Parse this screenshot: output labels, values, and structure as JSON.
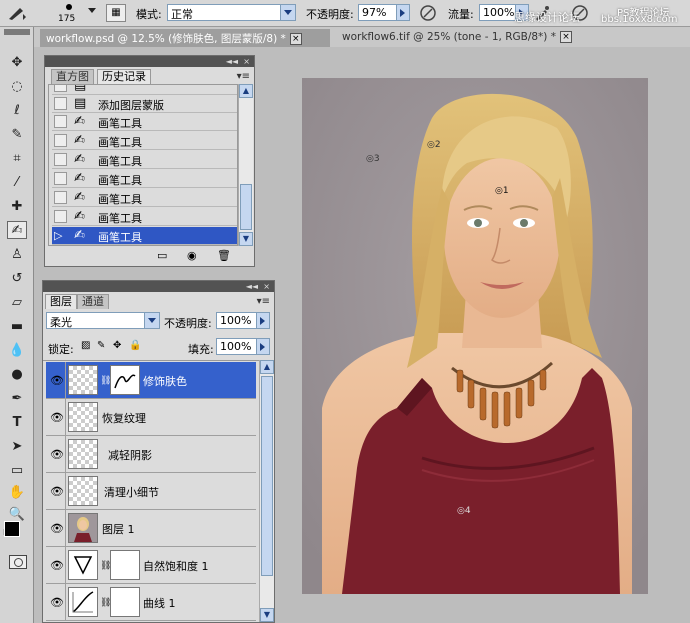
{
  "options_bar": {
    "brush_size": "175",
    "mode_label": "模式:",
    "mode_value": "正常",
    "opacity_label": "不透明度:",
    "opacity_value": "97%",
    "flow_label": "流量:",
    "flow_value": "100%",
    "watermark_text": "思缘设计论坛",
    "watermark_text_2": "PS教程论坛",
    "watermark_text_3": "bbs.16xx8.com"
  },
  "document_tabs": [
    {
      "label": "workflow.psd @ 12.5% (修饰肤色, 图层蒙版/8) *",
      "close": "×"
    },
    {
      "label": "workflow6.tif @ 25% (tone - 1, RGB/8*) *",
      "close": "×"
    }
  ],
  "history_panel": {
    "tabs": [
      "直方图",
      "历史记录"
    ],
    "collapse": "◄◄",
    "close": "×",
    "menu": "▾≡",
    "items": [
      {
        "label": ""
      },
      {
        "label": "添加图层蒙版"
      },
      {
        "label": "画笔工具"
      },
      {
        "label": "画笔工具"
      },
      {
        "label": "画笔工具"
      },
      {
        "label": "画笔工具"
      },
      {
        "label": "画笔工具"
      },
      {
        "label": "画笔工具"
      },
      {
        "label": "画笔工具"
      }
    ],
    "selected_index": 8
  },
  "layers_panel": {
    "tabs": [
      "图层",
      "通道"
    ],
    "collapse": "◄◄",
    "close": "×",
    "menu": "▾≡",
    "blend_mode": "柔光",
    "opacity_label": "不透明度:",
    "opacity_value": "100%",
    "lock_label": "锁定:",
    "fill_label": "填充:",
    "fill_value": "100%",
    "layers": [
      {
        "name": "修饰肤色",
        "selected": true
      },
      {
        "name": "恢复纹理",
        "selected": false
      },
      {
        "name": "减轻阴影",
        "selected": false
      },
      {
        "name": "清理小细节",
        "selected": false
      },
      {
        "name": "图层 1",
        "selected": false
      },
      {
        "name": "自然饱和度 1",
        "selected": false
      },
      {
        "name": "曲线 1",
        "selected": false
      }
    ]
  },
  "canvas": {
    "markers": [
      "1",
      "2",
      "3",
      "4"
    ]
  },
  "colors": {
    "panel_bg": "#dcdcdc",
    "selection_blue": "#3561cc",
    "background_gray": "#bdbdbd",
    "dress": "#7a1f2b",
    "hair": "#d8b46a",
    "backdrop": "#9f979b"
  }
}
